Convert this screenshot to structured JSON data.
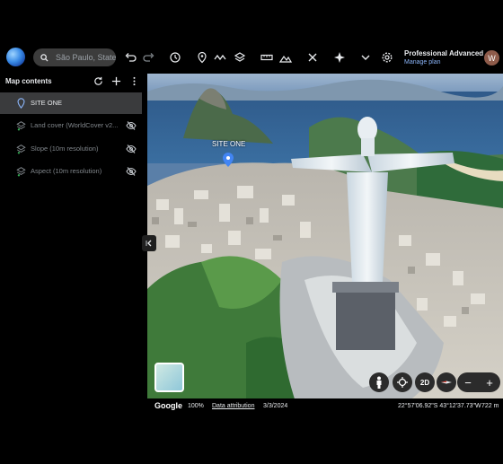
{
  "toolbar": {
    "search_placeholder": "São Paulo, State",
    "plan_name": "Professional Advanced",
    "manage_plan": "Manage plan",
    "avatar_initial": "W"
  },
  "sidebar": {
    "title": "Map contents",
    "items": [
      {
        "label": "SITE ONE",
        "icon": "map-pin-icon",
        "selected": true
      },
      {
        "label": "Land cover (WorldCover v2...",
        "icon": "layers-icon",
        "hidden": true
      },
      {
        "label": "Slope (10m resolution)",
        "icon": "layers-icon",
        "hidden": true
      },
      {
        "label": "Aspect (10m resolution)",
        "icon": "layers-icon",
        "hidden": true
      }
    ]
  },
  "map": {
    "site_label": "SITE ONE",
    "view_mode": "2D"
  },
  "status": {
    "brand": "Google",
    "zoom": "100%",
    "attribution": "Data attribution",
    "date": "3/3/2024",
    "coordinates": "22°57'06.92\"S 43°12'37.73\"W",
    "altitude": "722 m"
  },
  "colors": {
    "accent": "#8ab4f8",
    "pin": "#4285f4",
    "selected_row": "#3a3b3d"
  }
}
